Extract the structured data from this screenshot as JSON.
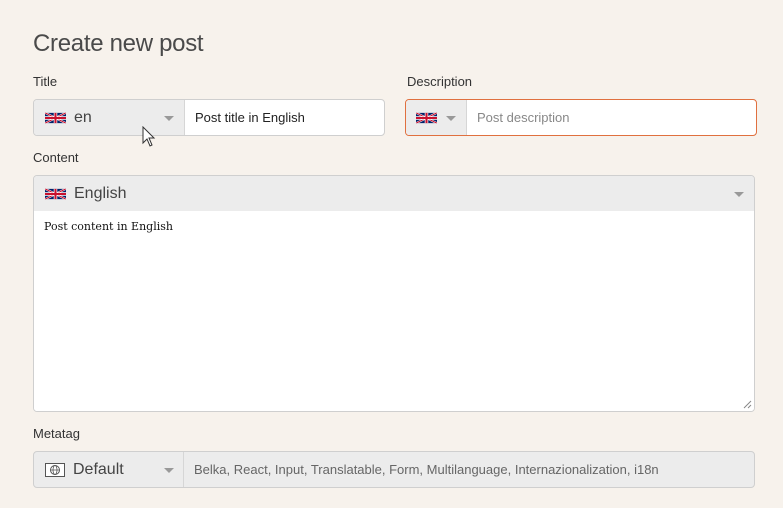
{
  "page": {
    "title": "Create new post"
  },
  "title_field": {
    "label": "Title",
    "language_code": "en",
    "language_flag": "uk-flag-icon",
    "value": "Post title in English"
  },
  "description_field": {
    "label": "Description",
    "language_flag": "uk-flag-icon",
    "placeholder": "Post description",
    "value": ""
  },
  "content_field": {
    "label": "Content",
    "language_name": "English",
    "language_flag": "uk-flag-icon",
    "value": "Post content in English"
  },
  "metatag_field": {
    "label": "Metatag",
    "language_name": "Default",
    "language_icon": "globe-icon",
    "value": "Belka, React, Input, Translatable, Form, Multilanguage, Internazionalization, i18n"
  },
  "colors": {
    "background": "#f7f2ec",
    "focus_border": "#e0703f",
    "select_background": "#ececec"
  }
}
